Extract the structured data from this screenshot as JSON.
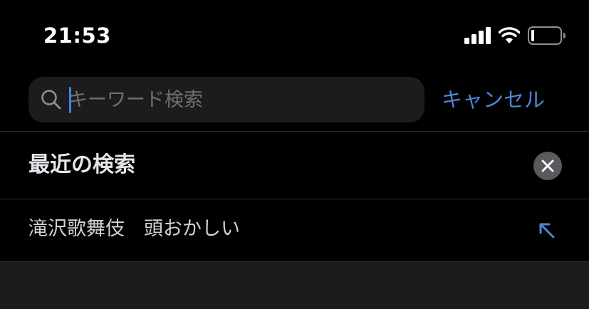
{
  "status_bar": {
    "time": "21:53",
    "icons": [
      "signal-icon",
      "wifi-icon",
      "battery-icon"
    ]
  },
  "search": {
    "placeholder": "キーワード検索",
    "value": "",
    "cancel_label": "キャンセル",
    "icon": "search-icon"
  },
  "recent": {
    "title": "最近の検索",
    "clear_icon": "close-icon",
    "items": [
      {
        "label": "滝沢歌舞伎　頭おかしい",
        "icon": "arrow-up-left-icon"
      }
    ]
  },
  "colors": {
    "background": "#000000",
    "field_background": "#1c1c1e",
    "accent": "#4f86d6",
    "caret": "#3d82f0",
    "placeholder": "#707074",
    "divider": "#2c2c2e"
  }
}
